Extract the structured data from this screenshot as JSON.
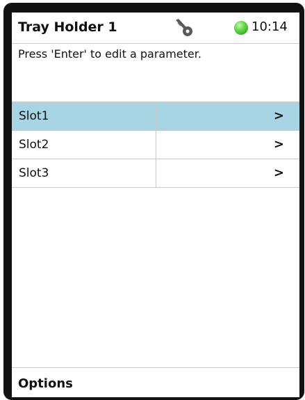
{
  "header": {
    "title": "Tray Holder 1",
    "key_icon": "key-icon",
    "status_color": "#3cb72a",
    "time": "10:14"
  },
  "hint": "Press 'Enter' to edit a parameter.",
  "list": {
    "selected_color": "#a8d5e3",
    "rows": [
      {
        "label": "Slot1",
        "arrow": ">"
      },
      {
        "label": "Slot2",
        "arrow": ">"
      },
      {
        "label": "Slot3",
        "arrow": ">"
      }
    ]
  },
  "footer": {
    "options_label": "Options"
  }
}
